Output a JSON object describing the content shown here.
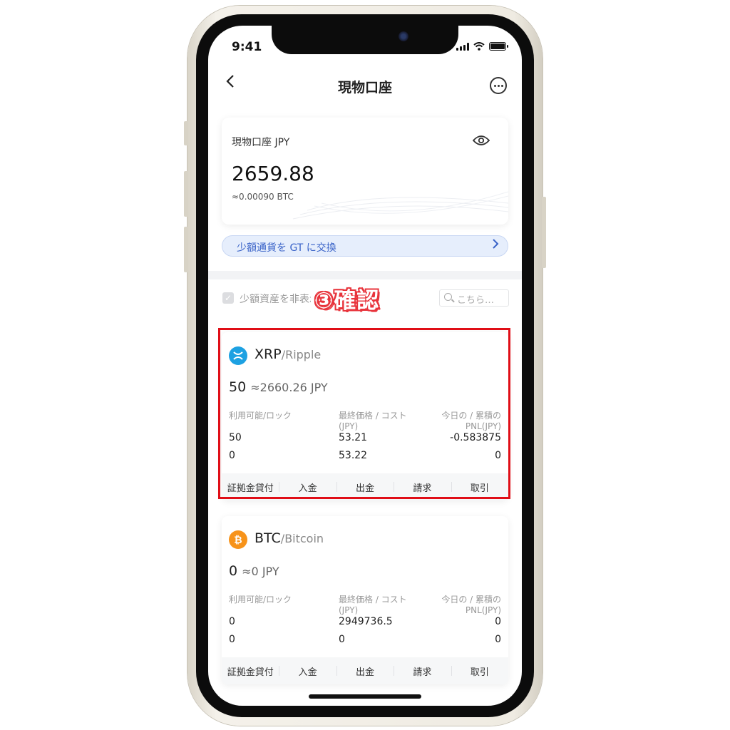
{
  "status": {
    "time": "9:41"
  },
  "nav": {
    "title": "現物口座"
  },
  "balance": {
    "label": "現物口座 JPY",
    "value": "2659.88",
    "btc": "≈0.00090 BTC"
  },
  "swap": {
    "label": "少額通貨を GT に交換"
  },
  "filter": {
    "hide_small_label": "少額資産を非表示",
    "search_placeholder": "こちら…"
  },
  "annotation": "③確認",
  "columns": {
    "available": "利用可能/ロック",
    "price_line1": "最終価格 / コスト",
    "price_line2": "(JPY)",
    "pnl_line1": "今日の / 累積の",
    "pnl_line2": "PNL(JPY)"
  },
  "assets": [
    {
      "symbol": "XRP",
      "name": "/Ripple",
      "amount": "50",
      "approx": "≈2660.26 JPY",
      "available": "50",
      "locked": "0",
      "last_price": "53.21",
      "cost": "53.22",
      "pnl_today": "-0.583875",
      "pnl_total": "0",
      "icon": "xrp-icon",
      "color": "#1da1e2"
    },
    {
      "symbol": "BTC",
      "name": "/Bitcoin",
      "amount": "0",
      "approx": "≈0 JPY",
      "available": "0",
      "locked": "0",
      "last_price": "2949736.5",
      "cost": "0",
      "pnl_today": "0",
      "pnl_total": "0",
      "icon": "bitcoin-icon",
      "color": "#f7931a"
    }
  ],
  "actions": [
    "証拠金貸付",
    "入金",
    "出金",
    "請求",
    "取引"
  ],
  "colors": {
    "accent": "#3a63c8",
    "highlight": "#e00e17"
  }
}
